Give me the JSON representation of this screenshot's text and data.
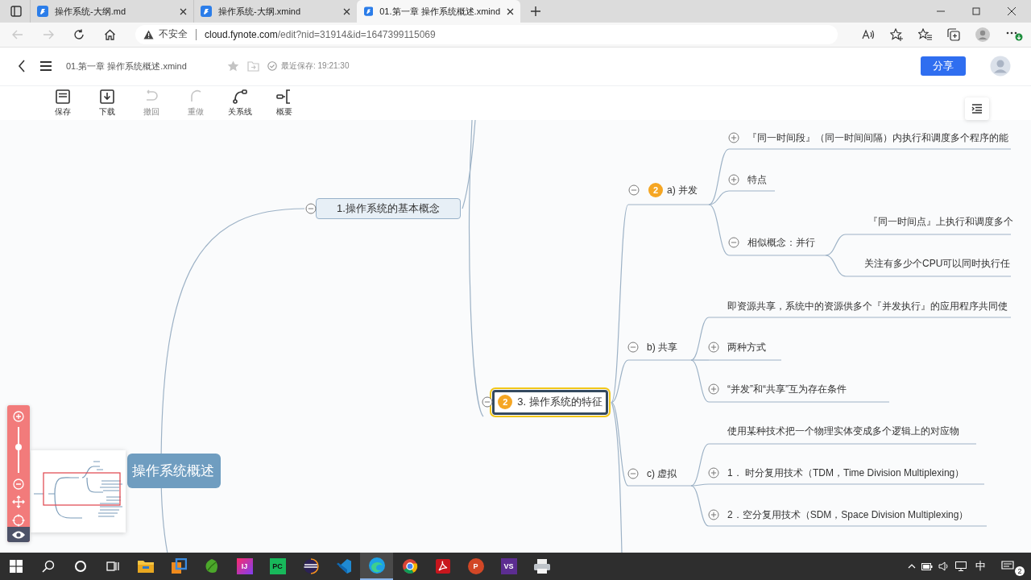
{
  "browser": {
    "tabs": [
      {
        "title": "操作系统-大纲.md",
        "selected": false
      },
      {
        "title": "操作系统-大纲.xmind",
        "selected": false
      },
      {
        "title": "01.第一章 操作系统概述.xmind",
        "selected": true
      }
    ],
    "security_label": "不安全",
    "url_host": "cloud.fynote.com",
    "url_path": "/edit?nid=31914&id=1647399115069"
  },
  "header": {
    "document_title": "01.第一章 操作系统概述.xmind",
    "save_status": "最近保存: 19:21:30",
    "share_button": "分享"
  },
  "toolbar": [
    {
      "label": "保存",
      "disabled": false
    },
    {
      "label": "下载",
      "disabled": false
    },
    {
      "label": "撤回",
      "disabled": true
    },
    {
      "label": "重做",
      "disabled": true
    },
    {
      "label": "关系线",
      "disabled": false
    },
    {
      "label": "概要",
      "disabled": false
    }
  ],
  "mindmap": {
    "root": {
      "text": "操作系统概述",
      "selected": false,
      "children": [
        {
          "text": "1.操作系统的基本概念",
          "expanded": true,
          "selected": false
        },
        {
          "text": "3. 操作系统的特征",
          "priority": "2",
          "expanded": true,
          "selected": true,
          "children": [
            {
              "text": "a) 并发",
              "priority": "2",
              "expanded": true,
              "selected": false,
              "children": [
                {
                  "text": "『同一时间段』（同一时间间隔）内执行和调度多个程序的能",
                  "expanded": false,
                  "selected": false
                },
                {
                  "text": "特点",
                  "expanded": false,
                  "selected": false
                },
                {
                  "text": "相似概念：并行",
                  "expanded": true,
                  "selected": false,
                  "children": [
                    {
                      "text": "『同一时间点』上执行和调度多个",
                      "selected": false
                    },
                    {
                      "text": "关注有多少个CPU可以同时执行任",
                      "selected": false
                    }
                  ]
                }
              ]
            },
            {
              "text": "b) 共享",
              "expanded": true,
              "selected": false,
              "children": [
                {
                  "text": "即资源共享，系统中的资源供多个『并发执行』的应用程序共同使",
                  "selected": false
                },
                {
                  "text": "两种方式",
                  "expanded": false,
                  "selected": false
                },
                {
                  "text": "“并发”和“共享”互为存在条件",
                  "expanded": false,
                  "selected": false
                }
              ]
            },
            {
              "text": "c) 虚拟",
              "expanded": true,
              "selected": false,
              "children": [
                {
                  "text": "使用某种技术把一个物理实体变成多个逻辑上的对应物",
                  "selected": false
                },
                {
                  "text": "1．  时分复用技术（TDM，Time Division Multiplexing）",
                  "expanded": false,
                  "selected": false
                },
                {
                  "text": "2．空分复用技术（SDM，Space Division Multiplexing）",
                  "expanded": false,
                  "selected": false
                }
              ]
            }
          ]
        }
      ]
    }
  },
  "zoom": {
    "level": 0.57
  },
  "taskbar": {
    "apps": [
      {
        "selected": false
      },
      {
        "selected": false
      },
      {
        "selected": false
      },
      {
        "selected": false,
        "label": "IJ"
      },
      {
        "selected": false,
        "label": "PC"
      },
      {
        "selected": false
      },
      {
        "selected": false
      },
      {
        "selected": true
      },
      {
        "selected": false
      },
      {
        "selected": false
      },
      {
        "selected": false,
        "label": "P"
      },
      {
        "selected": false,
        "label": "VS"
      },
      {
        "selected": false
      }
    ],
    "input_method": "中",
    "notification_count": "2"
  }
}
